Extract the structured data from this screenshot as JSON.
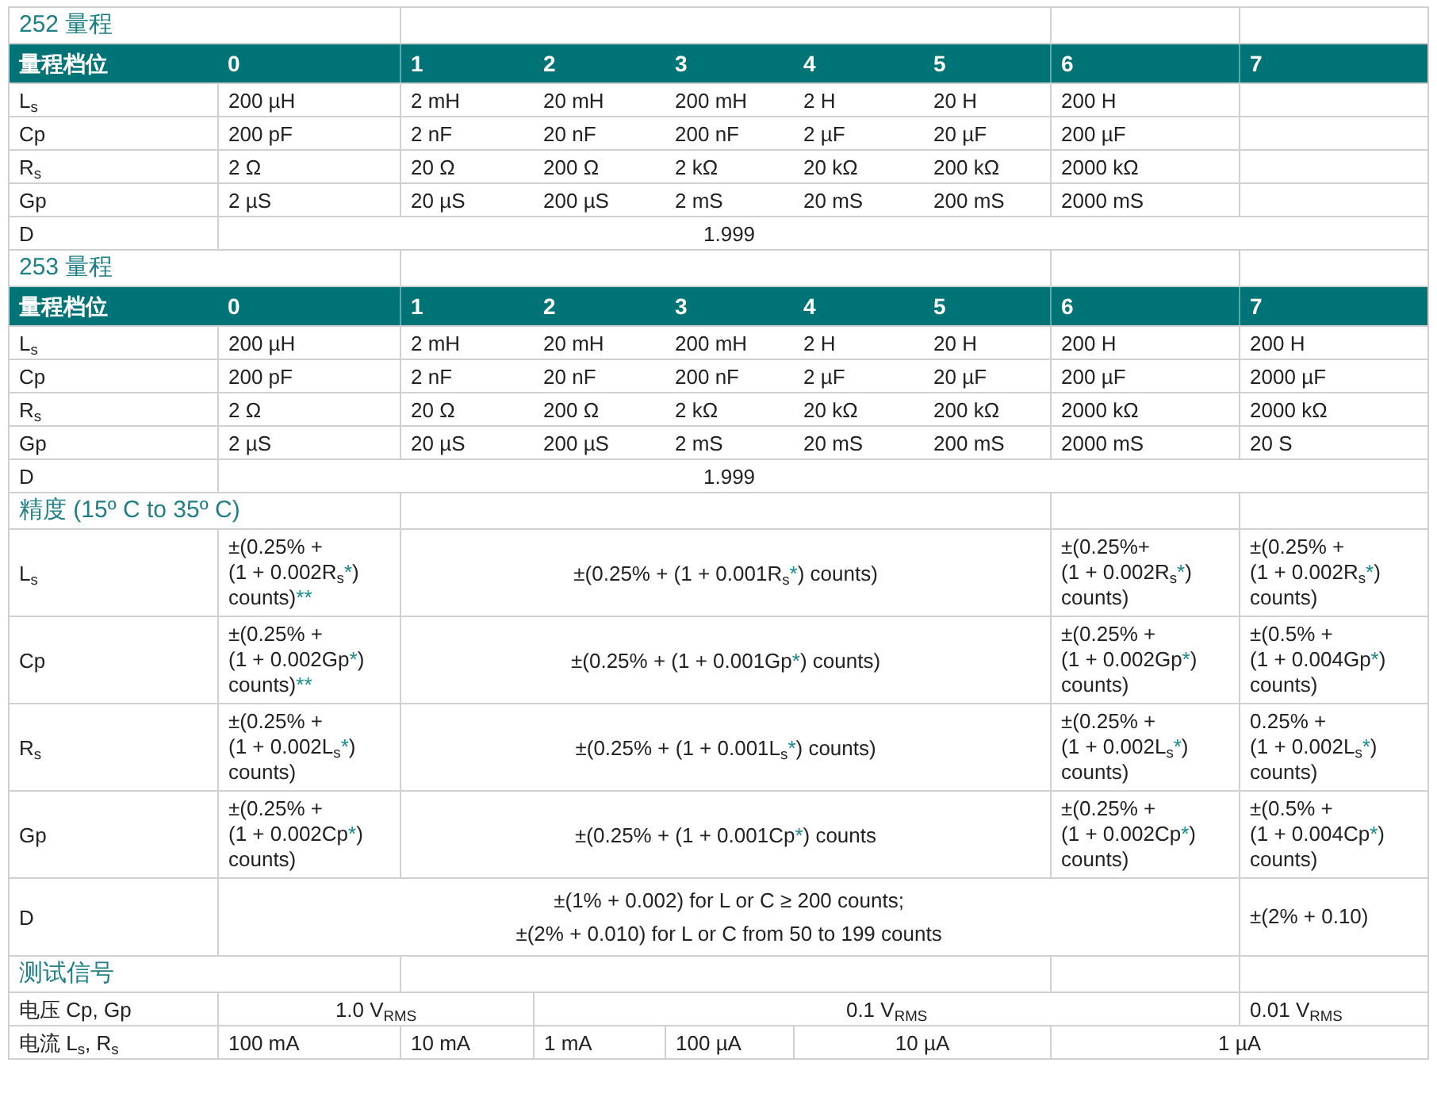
{
  "sections": [
    {
      "kind": "range",
      "title": "252  量程",
      "header": [
        "量程档位",
        "0",
        "1",
        "2",
        "3",
        "4",
        "5",
        "6",
        "7"
      ],
      "rows": [
        {
          "label": "L$_{s}$",
          "cells": [
            {
              "text": "200 µH"
            },
            {
              "text": "2 mH"
            },
            {
              "text": "20 mH"
            },
            {
              "text": "200 mH"
            },
            {
              "text": "2 H"
            },
            {
              "text": "20 H"
            },
            {
              "text": "200 H"
            }
          ]
        },
        {
          "label": "Cp",
          "cells": [
            {
              "text": "200 pF"
            },
            {
              "text": "2 nF"
            },
            {
              "text": "20 nF"
            },
            {
              "text": "200 nF"
            },
            {
              "text": "2 µF"
            },
            {
              "text": "20 µF"
            },
            {
              "text": "200 µF"
            }
          ]
        },
        {
          "label": "R$_{s}$",
          "cells": [
            {
              "text": "2 Ω"
            },
            {
              "text": "20 Ω"
            },
            {
              "text": "200 Ω"
            },
            {
              "text": "2 kΩ"
            },
            {
              "text": "20 kΩ"
            },
            {
              "text": "200 kΩ"
            },
            {
              "text": "2000 kΩ"
            }
          ]
        },
        {
          "label": "Gp",
          "cells": [
            {
              "text": "2 µS"
            },
            {
              "text": "20 µS"
            },
            {
              "text": "200 µS"
            },
            {
              "text": "2 mS"
            },
            {
              "text": "20 mS"
            },
            {
              "text": "200 mS"
            },
            {
              "text": "2000 mS"
            }
          ]
        },
        {
          "label": "D",
          "cells": [
            {
              "text": "1.999",
              "colspan": 7
            }
          ]
        }
      ]
    },
    {
      "kind": "range",
      "title": "253 量程",
      "header": [
        "量程档位",
        "0",
        "1",
        "2",
        "3",
        "4",
        "5",
        "6",
        "7"
      ],
      "rows": [
        {
          "label": "L$_{s}$",
          "cells": [
            {
              "text": "200 µH"
            },
            {
              "text": "2 mH"
            },
            {
              "text": "20 mH"
            },
            {
              "text": "200 mH"
            },
            {
              "text": "2 H"
            },
            {
              "text": "20 H"
            },
            {
              "text": "200 H"
            },
            {
              "text": "200 H"
            }
          ]
        },
        {
          "label": "Cp",
          "cells": [
            {
              "text": "200 pF"
            },
            {
              "text": "2 nF"
            },
            {
              "text": "20 nF"
            },
            {
              "text": "200 nF"
            },
            {
              "text": "2 µF"
            },
            {
              "text": "20 µF"
            },
            {
              "text": "200 µF"
            },
            {
              "text": "2000 µF"
            }
          ]
        },
        {
          "label": "R$_{s}$",
          "cells": [
            {
              "text": "2 Ω"
            },
            {
              "text": "20 Ω"
            },
            {
              "text": "200 Ω"
            },
            {
              "text": "2 kΩ"
            },
            {
              "text": "20 kΩ"
            },
            {
              "text": "200 kΩ"
            },
            {
              "text": "2000 kΩ"
            },
            {
              "text": "2000 kΩ"
            }
          ]
        },
        {
          "label": "Gp",
          "cells": [
            {
              "text": "2 µS"
            },
            {
              "text": "20 µS"
            },
            {
              "text": "200 µS"
            },
            {
              "text": "2 mS"
            },
            {
              "text": "20 mS"
            },
            {
              "text": "200 mS"
            },
            {
              "text": "2000 mS"
            },
            {
              "text": "20 S"
            }
          ]
        },
        {
          "label": "D",
          "cells": [
            {
              "text": "1.999",
              "colspan": 7
            }
          ]
        }
      ]
    },
    {
      "kind": "accuracy",
      "title": "精度 (15º C to 35º C)",
      "rows": [
        {
          "label": "L$_{s}$",
          "cells": [
            {
              "lines": [
                [
                  {
                    "text": "±(0.25% +"
                  }
                ],
                [
                  {
                    "text": "(1 + 0.002R$_{s}$"
                  },
                  {
                    "text": "*",
                    "kind": "note"
                  },
                  {
                    "text": ")"
                  }
                ],
                [
                  {
                    "text": "counts)"
                  },
                  {
                    "text": "**",
                    "kind": "note"
                  }
                ]
              ]
            },
            {
              "colspan": 5,
              "lines": [
                [
                  {
                    "text": "±(0.25% + (1 + 0.001R$_{s}$"
                  },
                  {
                    "text": "*",
                    "kind": "note"
                  },
                  {
                    "text": ") counts)"
                  }
                ]
              ]
            },
            {
              "lines": [
                [
                  {
                    "text": "±(0.25%+"
                  }
                ],
                [
                  {
                    "text": "(1 + 0.002R$_{s}$"
                  },
                  {
                    "text": "*",
                    "kind": "note"
                  },
                  {
                    "text": ")"
                  }
                ],
                [
                  {
                    "text": "counts)"
                  }
                ]
              ]
            },
            {
              "lines": [
                [
                  {
                    "text": "±(0.25% +"
                  }
                ],
                [
                  {
                    "text": "(1 + 0.002R$_{s}$"
                  },
                  {
                    "text": "*",
                    "kind": "note"
                  },
                  {
                    "text": ")"
                  }
                ],
                [
                  {
                    "text": "counts)"
                  }
                ]
              ]
            }
          ]
        },
        {
          "label": "Cp",
          "cells": [
            {
              "lines": [
                [
                  {
                    "text": "±(0.25% +"
                  }
                ],
                [
                  {
                    "text": "(1 + 0.002Gp"
                  },
                  {
                    "text": "*",
                    "kind": "note"
                  },
                  {
                    "text": ")"
                  }
                ],
                [
                  {
                    "text": "counts)"
                  },
                  {
                    "text": "**",
                    "kind": "note"
                  }
                ]
              ]
            },
            {
              "colspan": 5,
              "lines": [
                [
                  {
                    "text": "±(0.25% + (1 + 0.001Gp"
                  },
                  {
                    "text": "*",
                    "kind": "note"
                  },
                  {
                    "text": ") counts)"
                  }
                ]
              ]
            },
            {
              "lines": [
                [
                  {
                    "text": "±(0.25% +"
                  }
                ],
                [
                  {
                    "text": "(1 + 0.002Gp"
                  },
                  {
                    "text": "*",
                    "kind": "note"
                  },
                  {
                    "text": ")"
                  }
                ],
                [
                  {
                    "text": "counts)"
                  }
                ]
              ]
            },
            {
              "lines": [
                [
                  {
                    "text": "±(0.5% +"
                  }
                ],
                [
                  {
                    "text": "(1 + 0.004Gp"
                  },
                  {
                    "text": "*",
                    "kind": "note"
                  },
                  {
                    "text": ")"
                  }
                ],
                [
                  {
                    "text": "counts)"
                  }
                ]
              ]
            }
          ]
        },
        {
          "label": "R$_{s}$",
          "cells": [
            {
              "lines": [
                [
                  {
                    "text": "±(0.25% +"
                  }
                ],
                [
                  {
                    "text": "(1 + 0.002L$_{s}$"
                  },
                  {
                    "text": "*",
                    "kind": "note"
                  },
                  {
                    "text": ")"
                  }
                ],
                [
                  {
                    "text": "counts)"
                  }
                ]
              ]
            },
            {
              "colspan": 5,
              "lines": [
                [
                  {
                    "text": "±(0.25% + (1 + 0.001L$_{s}$"
                  },
                  {
                    "text": "*",
                    "kind": "note"
                  },
                  {
                    "text": ") counts)"
                  }
                ]
              ]
            },
            {
              "lines": [
                [
                  {
                    "text": "±(0.25% +"
                  }
                ],
                [
                  {
                    "text": "(1 + 0.002L$_{s}$"
                  },
                  {
                    "text": "*",
                    "kind": "note"
                  },
                  {
                    "text": ")"
                  }
                ],
                [
                  {
                    "text": "counts)"
                  }
                ]
              ]
            },
            {
              "lines": [
                [
                  {
                    "text": "0.25% +"
                  }
                ],
                [
                  {
                    "text": "(1 + 0.002L$_{s}$"
                  },
                  {
                    "text": "*",
                    "kind": "note"
                  },
                  {
                    "text": ")"
                  }
                ],
                [
                  {
                    "text": "counts)"
                  }
                ]
              ]
            }
          ]
        },
        {
          "label": "Gp",
          "cells": [
            {
              "lines": [
                [
                  {
                    "text": "±(0.25% +"
                  }
                ],
                [
                  {
                    "text": "(1 + 0.002Cp"
                  },
                  {
                    "text": "*",
                    "kind": "note"
                  },
                  {
                    "text": ")"
                  }
                ],
                [
                  {
                    "text": "counts)"
                  }
                ]
              ]
            },
            {
              "colspan": 5,
              "lines": [
                [
                  {
                    "text": "±(0.25% + (1 + 0.001Cp"
                  },
                  {
                    "text": "*",
                    "kind": "note"
                  },
                  {
                    "text": ") counts"
                  }
                ]
              ]
            },
            {
              "lines": [
                [
                  {
                    "text": "±(0.25% +"
                  }
                ],
                [
                  {
                    "text": "(1 + 0.002Cp"
                  },
                  {
                    "text": "*",
                    "kind": "note"
                  },
                  {
                    "text": ")"
                  }
                ],
                [
                  {
                    "text": "counts)"
                  }
                ]
              ]
            },
            {
              "lines": [
                [
                  {
                    "text": "±(0.5% +"
                  }
                ],
                [
                  {
                    "text": "(1 + 0.004Cp"
                  },
                  {
                    "text": "*",
                    "kind": "note"
                  },
                  {
                    "text": ")"
                  }
                ],
                [
                  {
                    "text": "counts)"
                  }
                ]
              ]
            }
          ]
        },
        {
          "label": "D",
          "cells": [
            {
              "colspan": 7,
              "lines": [
                [
                  {
                    "text": "±(1% + 0.002) for L or C ≥ 200 counts;"
                  }
                ],
                [
                  {
                    "text": "±(2% + 0.010) for L or C from 50 to 199 counts"
                  }
                ]
              ]
            },
            {
              "lines": [
                [
                  {
                    "text": "±(2% + 0.10)"
                  }
                ]
              ]
            }
          ]
        }
      ]
    },
    {
      "kind": "signal",
      "title": "测试信号",
      "rows": [
        {
          "label": "电压 Cp, Gp",
          "cells": [
            {
              "text": "1.0 V$_{RMS}$",
              "colspan": 2
            },
            {
              "text": "0.1 V$_{RMS}$",
              "colspan": 5
            },
            {
              "text": "0.01 V$_{RMS}$"
            }
          ]
        },
        {
          "label": "电流 L$_{s}$, R$_{s}$",
          "cells": [
            {
              "text": "100 mA"
            },
            {
              "text": "10 mA"
            },
            {
              "text": "1 mA"
            },
            {
              "text": "100 µA"
            },
            {
              "text": "10 µA",
              "colspan": 2
            },
            {
              "text": "1 µA",
              "colspan": 2
            }
          ]
        }
      ]
    }
  ]
}
